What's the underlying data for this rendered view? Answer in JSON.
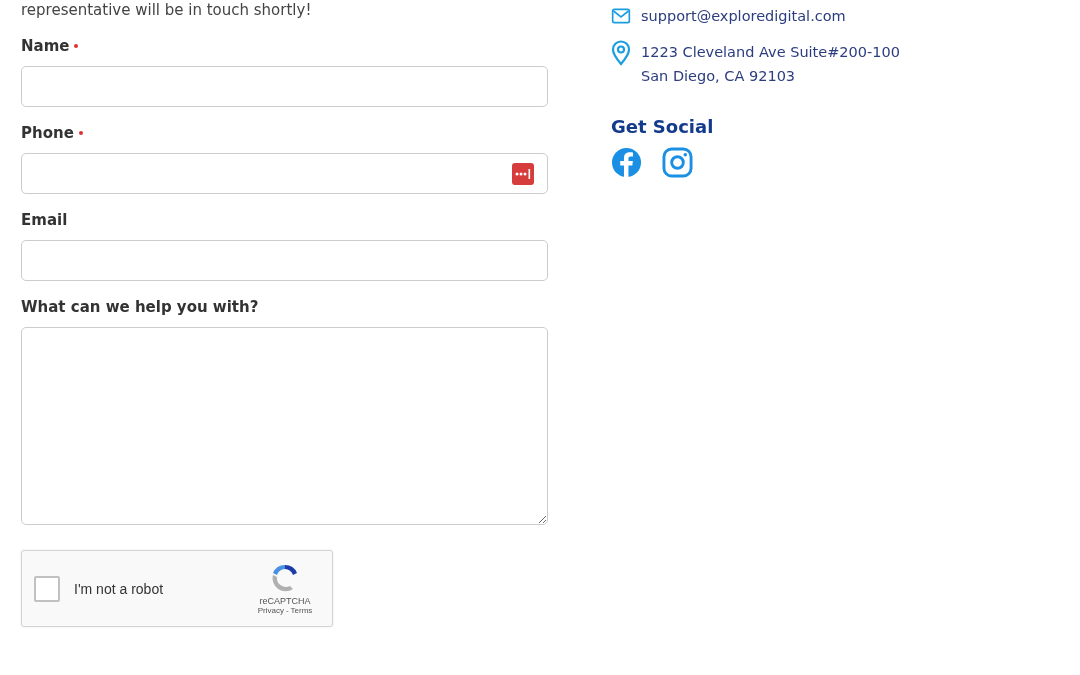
{
  "intro": "representative will be in touch shortly!",
  "fields": [
    {
      "label": "Name",
      "required": true,
      "kind": "text",
      "password_manager_icon": false
    },
    {
      "label": "Phone",
      "required": true,
      "kind": "text",
      "password_manager_icon": true
    },
    {
      "label": "Email",
      "required": false,
      "kind": "text",
      "password_manager_icon": false
    },
    {
      "label": "What can we help you with?",
      "required": false,
      "kind": "textarea"
    }
  ],
  "captcha": {
    "label": "I'm not a robot",
    "checked": false,
    "brand": "reCAPTCHA",
    "privacy": "Privacy",
    "separator": "-",
    "terms": "Terms"
  },
  "contact": [
    {
      "kind": "email",
      "lines": [
        "support@exploredigital.com"
      ]
    },
    {
      "kind": "address",
      "lines": [
        "1223 Cleveland Ave Suite#200-100",
        "San Diego, CA 92103"
      ]
    }
  ],
  "social": {
    "title": "Get Social",
    "links": [
      {
        "kind": "facebook"
      },
      {
        "kind": "instagram"
      }
    ]
  }
}
